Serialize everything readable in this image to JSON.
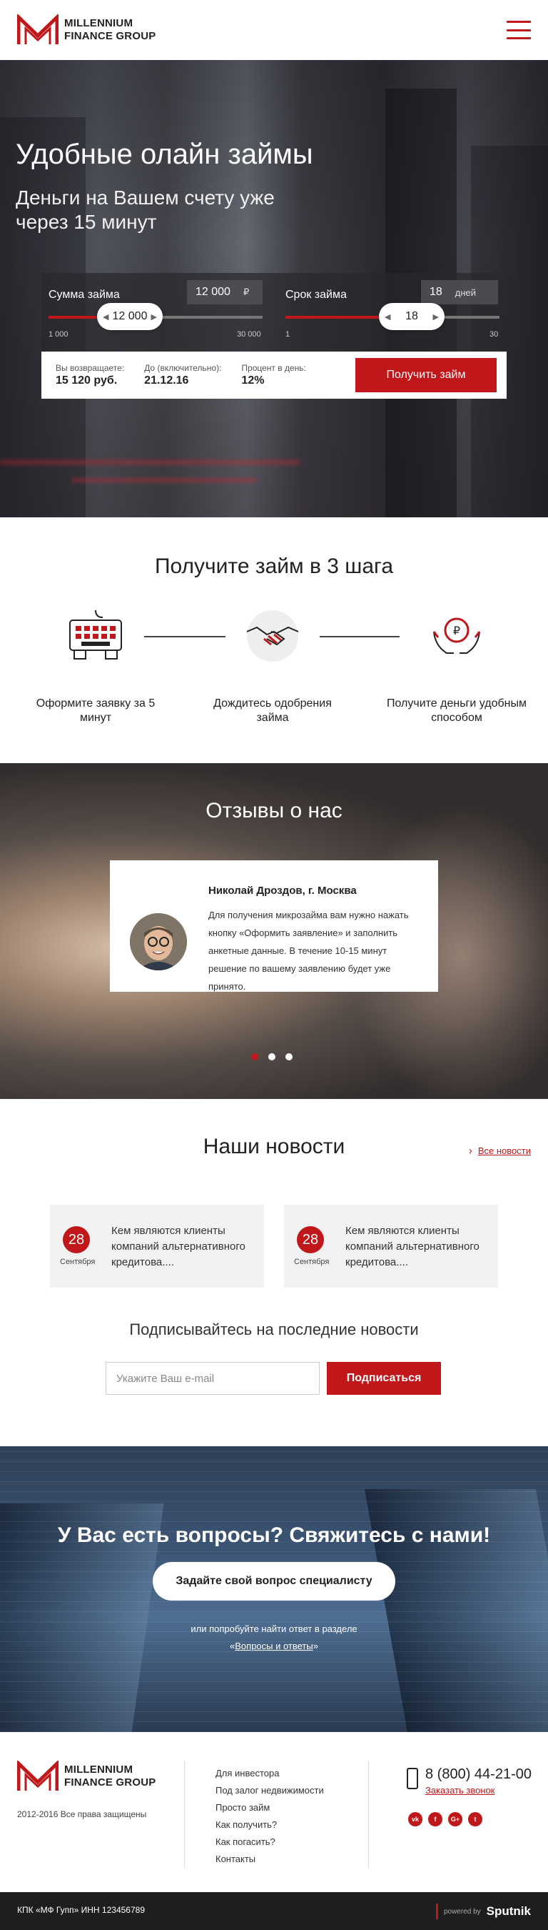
{
  "brand": {
    "line1": "MILLENNIUM",
    "line2": "FINANCE GROUP"
  },
  "hero": {
    "title": "Удобные олайн займы",
    "subtitle": "Деньги на Вашем счету уже через 15 минут"
  },
  "calculator": {
    "amount": {
      "label": "Сумма займа",
      "value": "12 000",
      "unit": "₽",
      "thumb": "12 000",
      "min": "1 000",
      "max": "30 000",
      "level": 0.38
    },
    "term": {
      "label": "Срок займа",
      "value": "18",
      "unit": "дней",
      "thumb": "18",
      "min": "1",
      "max": "30",
      "level": 0.59
    },
    "return_label": "Вы возвращаете:",
    "return_value": "15 120 руб.",
    "until_label": "До (включительно):",
    "until_value": "21.12.16",
    "percent_label": "Процент в день:",
    "percent_value": "12%",
    "button": "Получить займ"
  },
  "steps": {
    "title": "Получите займ в 3 шага",
    "items": [
      {
        "icon": "keyboard-icon",
        "text": "Оформите заявку за 5 минут"
      },
      {
        "icon": "handshake-icon",
        "text": "Дождитесь одобрения займа"
      },
      {
        "icon": "ruble-hands-icon",
        "text": "Получите деньги удобным способом"
      }
    ]
  },
  "reviews": {
    "title": "Отзывы о нас",
    "name": "Николай Дроздов, г. Москва",
    "text": "Для получения микрозайма вам нужно нажать кнопку «Оформить заявление» и заполнить анкетные данные. В течение 10-15 минут решение по вашему заявлению будет уже принято.",
    "active_dot": 0
  },
  "news": {
    "title": "Наши новости",
    "all_link": "Все новости",
    "items": [
      {
        "day": "28",
        "month": "Сентября",
        "text": "Кем  являются клиенты компаний альтернативного кредитова...."
      },
      {
        "day": "28",
        "month": "Сентября",
        "text": "Кем  являются клиенты компаний альтернативного кредитова...."
      }
    ],
    "subscribe_title": "Подписывайтесь на последние новости",
    "email_placeholder": "Укажите Ваш e-mail",
    "subscribe_button": "Подписаться"
  },
  "contact": {
    "title": "У Вас есть вопросы? Свяжитесь с нами!",
    "button": "Задайте свой вопрос специалисту",
    "note_prefix": "или попробуйте найти ответ в разделе",
    "quote_open": "«",
    "link": "Вопросы и ответы",
    "quote_close": "»"
  },
  "footer": {
    "copyright": "2012-2016 Все права защищены",
    "menu": [
      "Для инвестора",
      "Под залог недвижимости",
      "Просто займ",
      "Как получить?",
      "Как погасить?",
      "Контакты"
    ],
    "phone": "8 (800) 44-21-00",
    "callback": "Заказать звонок",
    "socials": [
      "vk",
      "f",
      "G+",
      "t"
    ],
    "legal": "КПК «МФ Гупп» ИНН 123456789",
    "powered": "powered by",
    "sputnik": "Sputnik"
  },
  "colors": {
    "accent": "#c0171a",
    "dark": "#1e1e1e"
  }
}
